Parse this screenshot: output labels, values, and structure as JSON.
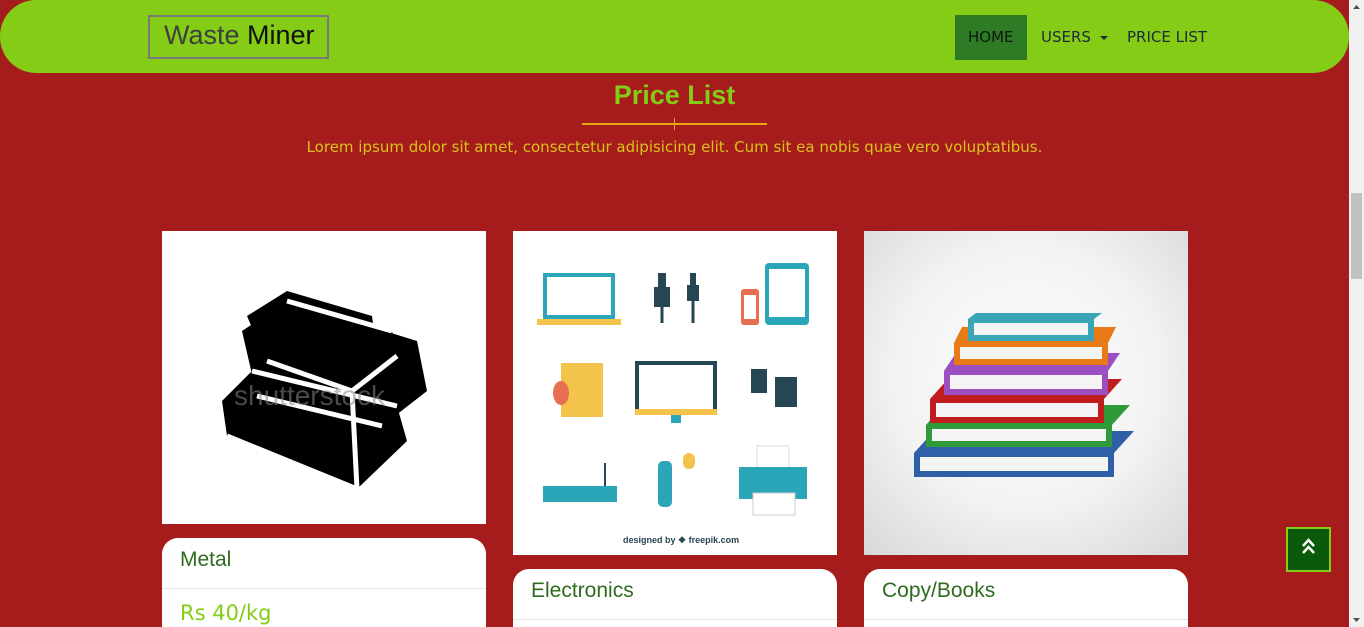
{
  "navbar": {
    "brand_part1": "Waste",
    "brand_part2": "Miner",
    "items": [
      {
        "label": "HOME"
      },
      {
        "label": "USERS"
      },
      {
        "label": "PRICE LIST"
      }
    ]
  },
  "section": {
    "title": "Price List",
    "lead": "Lorem ipsum dolor sit amet, consectetur adipisicing elit. Cum sit ea nobis quae vero voluptatibus."
  },
  "cards": [
    {
      "title": "Metal",
      "price": "Rs 40/kg",
      "image_watermark": "shutterstock"
    },
    {
      "title": "Electronics",
      "image_credit": "designed by ❖ freepik.com"
    },
    {
      "title": "Copy/Books"
    }
  ],
  "colors": {
    "page_bg": "#a61c1c",
    "navbar_bg": "#84cc16",
    "accent_green": "#84cc16",
    "title_green": "#2f6b1f",
    "gold": "#e8a813"
  },
  "icons": {
    "to_top": "double-chevron-up-icon",
    "nav_dropdown": "caret-down-icon"
  }
}
